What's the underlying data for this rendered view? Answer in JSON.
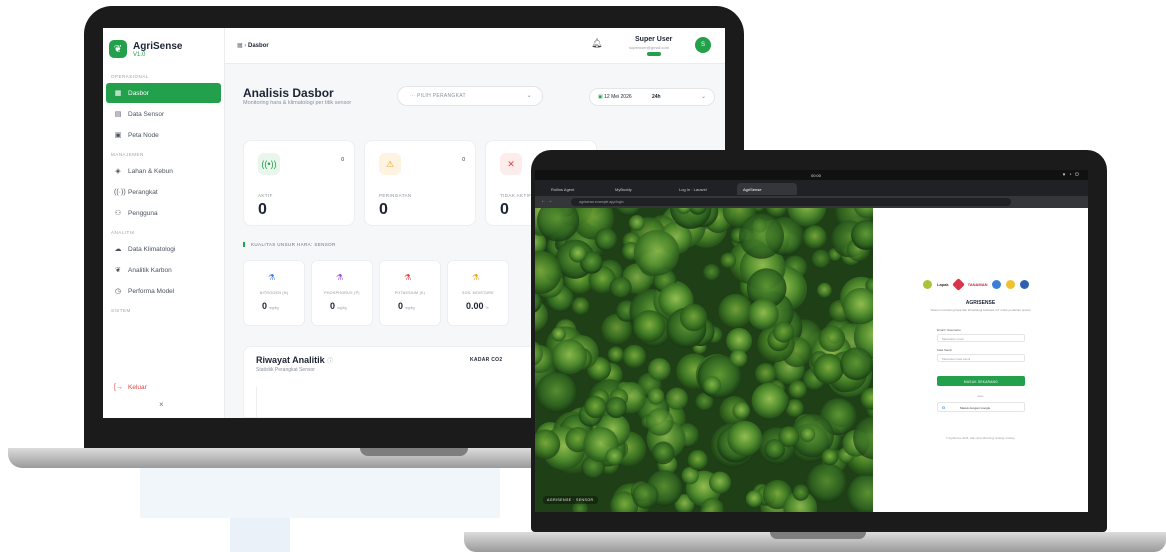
{
  "colors": {
    "accent": "#22a04b",
    "warning": "#f0a020",
    "danger": "#e0443e",
    "text": "#1d2433"
  },
  "dashboard": {
    "brand": {
      "name": "AgriSense",
      "version": "V1.0"
    },
    "sidebar": {
      "sections": [
        {
          "label": "OPERASIONAL",
          "items": [
            {
              "label": "Dasbor",
              "icon": "grid-icon",
              "active": true
            },
            {
              "label": "Data Sensor",
              "icon": "database-icon"
            },
            {
              "label": "Peta Node",
              "icon": "map-icon"
            }
          ]
        },
        {
          "label": "MANAJEMEN",
          "items": [
            {
              "label": "Lahan & Kebun",
              "icon": "layers-icon"
            },
            {
              "label": "Perangkat",
              "icon": "signal-icon"
            },
            {
              "label": "Pengguna",
              "icon": "users-icon"
            }
          ]
        },
        {
          "label": "ANALITIK",
          "items": [
            {
              "label": "Data Klimatologi",
              "icon": "cloud-icon"
            },
            {
              "label": "Analitik Karbon",
              "icon": "leaf-icon"
            },
            {
              "label": "Performa Model",
              "icon": "chart-icon"
            }
          ]
        },
        {
          "label": "SISTEM",
          "items": []
        }
      ],
      "logout": "Keluar",
      "collapse": "×"
    },
    "topbar": {
      "breadcrumb_sep": "›",
      "breadcrumb_current": "Dasbor",
      "user_name": "Super User",
      "user_email": "superuser@gmail.com",
      "avatar_initial": "S"
    },
    "header": {
      "title": "Analisis Dasbor",
      "subtitle": "Monitoring hara & klimatologi per titik sensor",
      "device_placeholder": "PILIH PERANGKAT",
      "date": "12 Mei 2026",
      "range": "24h"
    },
    "stats": [
      {
        "label": "AKTIF",
        "value": "0",
        "count": "0",
        "icon": "signal-icon",
        "color": "#22a04b",
        "bg": "#e8f6ec",
        "glyph": "((•))"
      },
      {
        "label": "PERINGATAN",
        "value": "0",
        "count": "0",
        "icon": "warning-icon",
        "color": "#f0a020",
        "bg": "#fdf3e0",
        "glyph": "⚠"
      },
      {
        "label": "TIDAK AKTIF",
        "value": "0",
        "count": "",
        "icon": "close-icon",
        "color": "#e0443e",
        "bg": "#fdecec",
        "glyph": "✕"
      }
    ],
    "npk_title": "KUALITAS UNSUR HARA: SENSOR",
    "npk": [
      {
        "label": "NITROGEN (N)",
        "value": "0",
        "unit": "mg/kg",
        "color": "#4a7bd0"
      },
      {
        "label": "PHOSPHORUS (P)",
        "value": "0",
        "unit": "mg/kg",
        "color": "#9b4ad0"
      },
      {
        "label": "POTASSIUM (K)",
        "value": "0",
        "unit": "mg/kg",
        "color": "#e0443e"
      },
      {
        "label": "SOIL MOISTURE",
        "value": "0.00",
        "unit": "%",
        "color": "#f0a020"
      }
    ],
    "history": {
      "title": "Riwayat Analitik",
      "subtitle": "Statistik Perangkat Sensor",
      "selector": "KADAR CO2"
    }
  },
  "login_screen": {
    "os_clock": "00:00",
    "tabs": [
      "Rollins Agent",
      "MyBuddy",
      "Log In · Laravel",
      "AgriSense"
    ],
    "address": "agrisense.example.app/login",
    "image_caption": "AGRISENSE · SENSOR",
    "partners_text": [
      "Lapak",
      "TANAMAN"
    ],
    "title": "AGRISENSE",
    "subtitle": "Sistem monitoring hara dan klimatologi berbasis IoT untuk pertanian presisi",
    "email_label": "Email / Username",
    "email_placeholder": "Masukkan email",
    "password_label": "Kata Sandi",
    "password_placeholder": "Masukkan kata sandi",
    "login_button": "MASUK SEKARANG",
    "or_text": "atau",
    "google_button": "Masuk dengan Google",
    "footer": "© AgriSense 2026. Hak cipta dilindungi undang-undang."
  }
}
